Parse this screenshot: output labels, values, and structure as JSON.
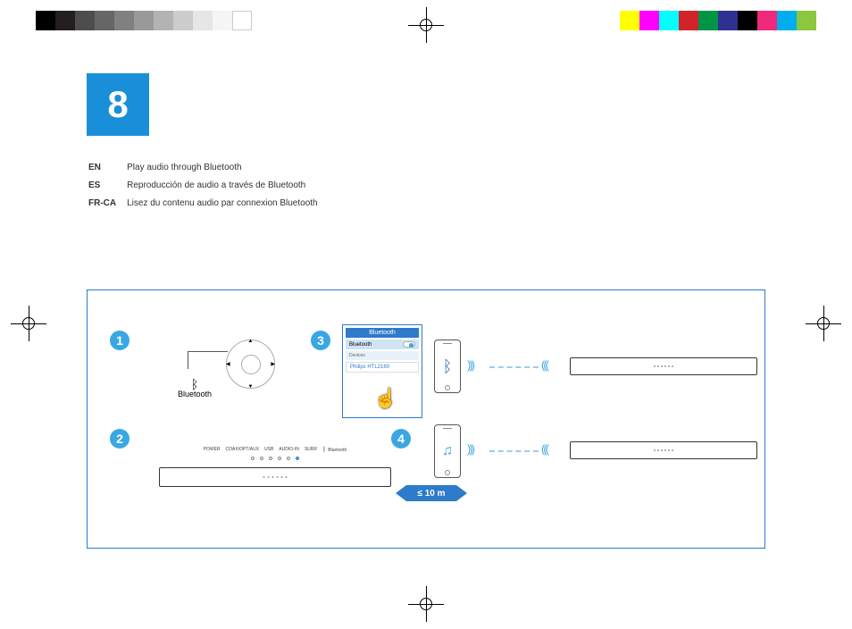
{
  "page_number": "8",
  "instructions": [
    {
      "code": "EN",
      "text": "Play audio through Bluetooth"
    },
    {
      "code": "ES",
      "text": "Reproducción de audio a través de Bluetooth"
    },
    {
      "code": "FR-CA",
      "text": "Lisez du contenu audio par connexion Bluetooth"
    }
  ],
  "steps": {
    "s1": "1",
    "s2": "2",
    "s3": "3",
    "s4": "4"
  },
  "bluetooth_label": "Bluetooth",
  "led_labels": [
    "POWER",
    "COAX/OPT/AUX",
    "USB",
    "AUDIO-IN",
    "SURR"
  ],
  "pairing": {
    "title": "Bluetooth",
    "row_label": "Bluetooth",
    "toggle_state": "ON",
    "section": "Devices",
    "device_name": "Philips HTL2160"
  },
  "distance": "≤ 10 m",
  "colorbar_left": [
    "#000000",
    "#231f20",
    "#4d4d4d",
    "#666666",
    "#808080",
    "#999999",
    "#b3b3b3",
    "#cccccc",
    "#e6e6e6",
    "#f5f5f5",
    "#ffffff"
  ],
  "colorbar_right": [
    "#ffff00",
    "#ff00ff",
    "#00ffff",
    "#d2232a",
    "#009444",
    "#2e3192",
    "#000000",
    "#ee2a7b",
    "#00aeef",
    "#8dc63f"
  ]
}
